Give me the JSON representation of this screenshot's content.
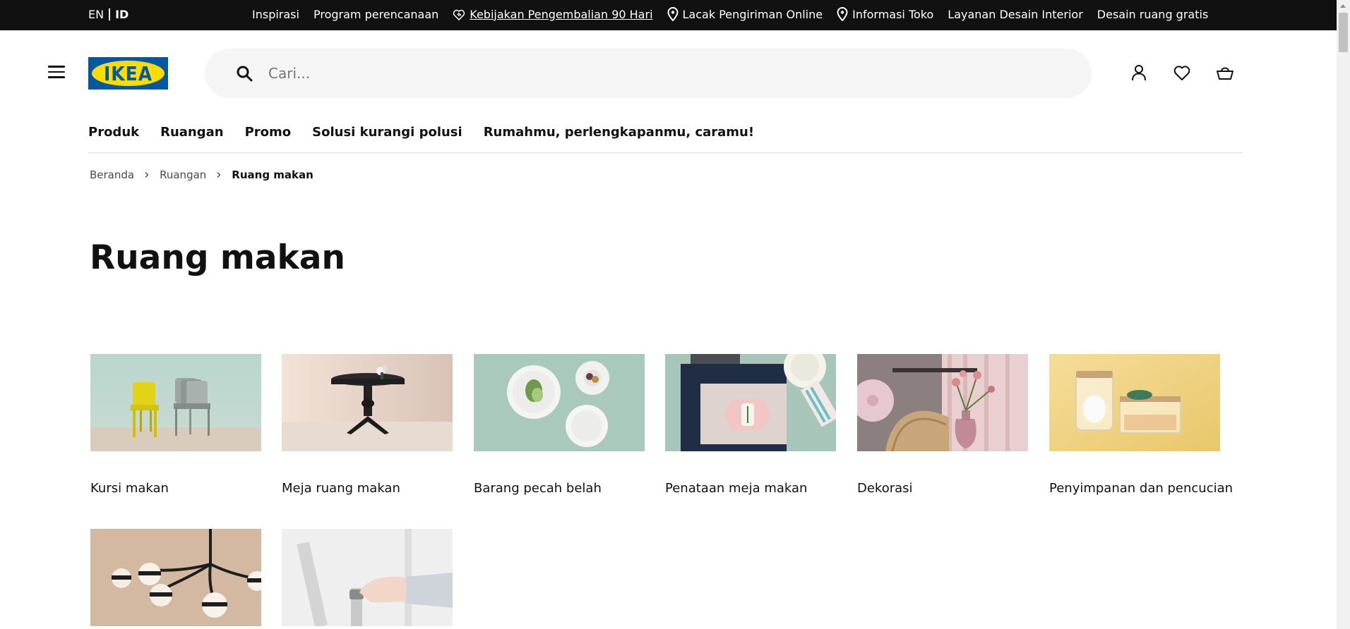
{
  "topbar": {
    "lang_en": "EN",
    "lang_id": "ID",
    "links": [
      {
        "label": "Inspirasi",
        "icon": ""
      },
      {
        "label": "Program perencanaan",
        "icon": ""
      },
      {
        "label": "Kebijakan Pengembalian 90 Hari",
        "icon": "heart-handshake-icon"
      },
      {
        "label": "Lacak Pengiriman Online",
        "icon": "location-pin-icon"
      },
      {
        "label": "Informasi Toko",
        "icon": "location-pin-icon"
      },
      {
        "label": "Layanan Desain Interior",
        "icon": ""
      },
      {
        "label": "Desain ruang gratis",
        "icon": ""
      }
    ]
  },
  "header": {
    "logo_text": "IKEA",
    "search_placeholder": "Cari...",
    "icons": [
      "user-icon",
      "heart-icon",
      "cart-icon"
    ]
  },
  "nav": {
    "items": [
      "Produk",
      "Ruangan",
      "Promo",
      "Solusi kurangi polusi",
      "Rumahmu, perlengkapanmu, caramu!"
    ]
  },
  "breadcrumb": {
    "items": [
      "Beranda",
      "Ruangan"
    ],
    "current": "Ruang makan"
  },
  "page": {
    "title": "Ruang makan"
  },
  "categories": [
    {
      "label": "Kursi makan"
    },
    {
      "label": "Meja ruang makan"
    },
    {
      "label": "Barang pecah belah"
    },
    {
      "label": "Penataan meja makan"
    },
    {
      "label": "Dekorasi"
    },
    {
      "label": "Penyimpanan dan pencucian"
    },
    {
      "label": ""
    },
    {
      "label": ""
    }
  ],
  "colors": {
    "topbar_bg": "#111111",
    "ikea_blue": "#0058a3",
    "ikea_yellow": "#ffdb00"
  }
}
